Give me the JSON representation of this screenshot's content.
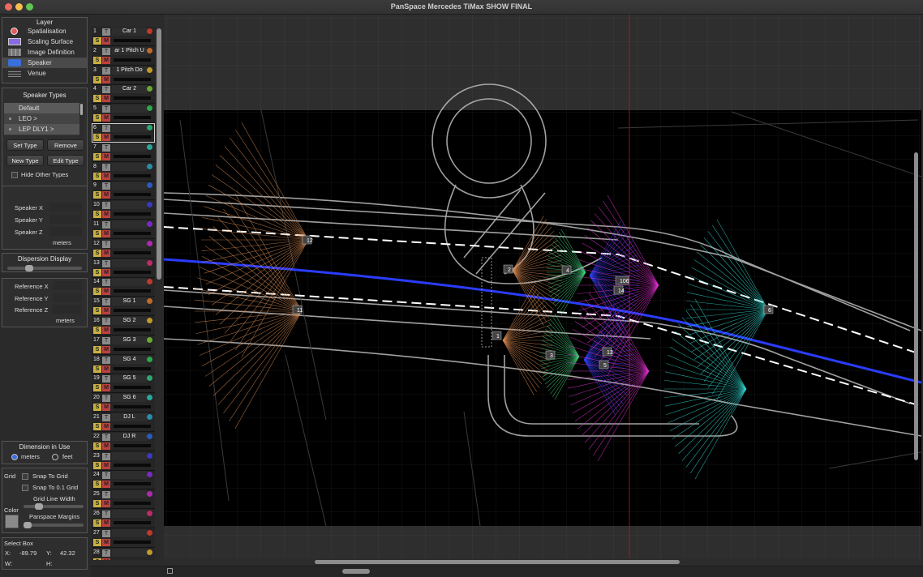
{
  "window": {
    "title": "PanSpace Mercedes TiMax SHOW FINAL"
  },
  "layer_panel": {
    "title": "Layer",
    "items": [
      {
        "label": "Spatialisation",
        "icon": "spatialisation-icon"
      },
      {
        "label": "Scaling Surface",
        "icon": "scaling-surface-icon"
      },
      {
        "label": "Image Definition",
        "icon": "image-definition-icon"
      },
      {
        "label": "Speaker",
        "icon": "speaker-icon",
        "selected": true
      },
      {
        "label": "Venue",
        "icon": "venue-icon"
      }
    ]
  },
  "speaker_types": {
    "title": "Speaker Types",
    "items": [
      "Default",
      "LEO >",
      "LEP DLY1 >"
    ],
    "set_type": "Set Type",
    "remove": "Remove",
    "new_type": "New Type",
    "edit_type": "Edit Type",
    "hide_other_types": "Hide Other Types"
  },
  "speaker_pos": {
    "x": "Speaker X",
    "y": "Speaker Y",
    "z": "Speaker Z",
    "units": "meters"
  },
  "dispersion": {
    "title": "Dispersion Display",
    "level": 0.3
  },
  "reference": {
    "x": "Reference X",
    "y": "Reference Y",
    "z": "Reference Z",
    "units": "meters"
  },
  "dimension": {
    "title": "Dimension in Use",
    "meters": "meters",
    "feet": "feet",
    "selected": "meters"
  },
  "grid": {
    "label": "Grid",
    "snap_to_grid": "Snap To Grid",
    "snap_to_01": "Snap To 0.1 Grid",
    "line_width": "Grid Line Width",
    "color": "Color",
    "margins": "Panspace Margins"
  },
  "select_box": {
    "title": "Select Box",
    "x_label": "X:",
    "x_value": "-89.79",
    "y_label": "Y:",
    "y_value": "42.32",
    "w_label": "W:",
    "h_label": "H:"
  },
  "channels": [
    {
      "n": "1",
      "name": "Car 1",
      "color": "#c0392b"
    },
    {
      "n": "2",
      "name": "ar 1 Pitch U",
      "color": "#c0692b"
    },
    {
      "n": "3",
      "name": "1  Pitch Do",
      "color": "#c09a2b"
    },
    {
      "n": "4",
      "name": "Car 2",
      "color": "#6aa830"
    },
    {
      "n": "5",
      "name": "",
      "color": "#2ea84a"
    },
    {
      "n": "6",
      "name": "",
      "color": "#2ea870",
      "selected": true
    },
    {
      "n": "7",
      "name": "",
      "color": "#2aa89a"
    },
    {
      "n": "8",
      "name": "",
      "color": "#2a8ca8"
    },
    {
      "n": "9",
      "name": "",
      "color": "#2a5ac0"
    },
    {
      "n": "10",
      "name": "",
      "color": "#3a3ac0"
    },
    {
      "n": "11",
      "name": "",
      "color": "#7a2ac0"
    },
    {
      "n": "12",
      "name": "",
      "color": "#b02ab0"
    },
    {
      "n": "13",
      "name": "",
      "color": "#c02a6a"
    },
    {
      "n": "14",
      "name": "",
      "color": "#c0392b"
    },
    {
      "n": "15",
      "name": "SG 1",
      "color": "#c0692b"
    },
    {
      "n": "16",
      "name": "SG 2",
      "color": "#c09a2b"
    },
    {
      "n": "17",
      "name": "SG 3",
      "color": "#6aa830"
    },
    {
      "n": "18",
      "name": "SG 4",
      "color": "#2ea84a"
    },
    {
      "n": "19",
      "name": "SG 5",
      "color": "#2ea870"
    },
    {
      "n": "20",
      "name": "SG 6",
      "color": "#2aa89a"
    },
    {
      "n": "21",
      "name": "DJ L",
      "color": "#2a8ca8"
    },
    {
      "n": "22",
      "name": "DJ R",
      "color": "#2a5ac0"
    },
    {
      "n": "23",
      "name": "",
      "color": "#3a3ac0"
    },
    {
      "n": "24",
      "name": "",
      "color": "#7a2ac0"
    },
    {
      "n": "25",
      "name": "",
      "color": "#b02ab0"
    },
    {
      "n": "26",
      "name": "",
      "color": "#c02a6a"
    },
    {
      "n": "27",
      "name": "",
      "color": "#c0392b"
    },
    {
      "n": "28",
      "name": "",
      "color": "#c09a2b"
    }
  ],
  "channel_buttons": {
    "t": "T",
    "s": "S",
    "m": "M"
  },
  "canvas_speakers": [
    "12",
    "11",
    "2",
    "1",
    "4",
    "3",
    "106",
    "14",
    "13",
    "5",
    "6"
  ],
  "colors": {
    "accent_blue": "#2a3cff",
    "fan_orange": "#d98a50",
    "fan_green": "#3fd07a",
    "fan_blue": "#3040ff",
    "fan_magenta": "#e030d0",
    "fan_cyan": "#30d8d0"
  }
}
